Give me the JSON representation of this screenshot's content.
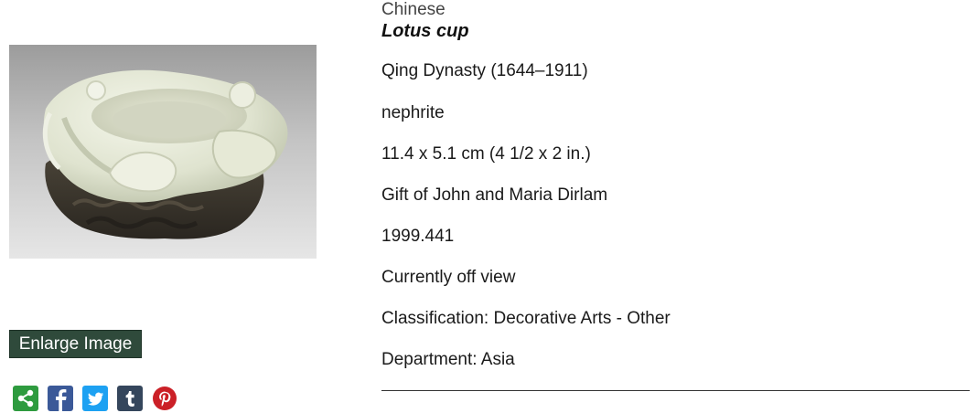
{
  "artwork": {
    "image_alt": "Lotus cup",
    "culture": "Chinese",
    "title": "Lotus cup",
    "date": "Qing Dynasty (1644–1911)",
    "medium": "nephrite",
    "dimensions": "11.4 x 5.1 cm (4 1/2 x 2 in.)",
    "credit_line": "Gift of John and Maria Dirlam",
    "accession_number": "1999.441",
    "location_status": "Currently off view",
    "classification": "Classification: Decorative Arts - Other",
    "department": "Department: Asia"
  },
  "actions": {
    "enlarge_label": "Enlarge Image"
  },
  "share": {
    "icons": [
      "share-icon",
      "facebook-icon",
      "twitter-icon",
      "tumblr-icon",
      "pinterest-icon"
    ],
    "colors": {
      "share": "#2e9b3f",
      "facebook": "#3b5998",
      "twitter": "#1da1f2",
      "tumblr": "#35465c",
      "pinterest": "#cb2027"
    }
  },
  "colors": {
    "enlarge_bg": "#2f4a3b",
    "text": "#1a1a1a",
    "divider": "#333333"
  }
}
